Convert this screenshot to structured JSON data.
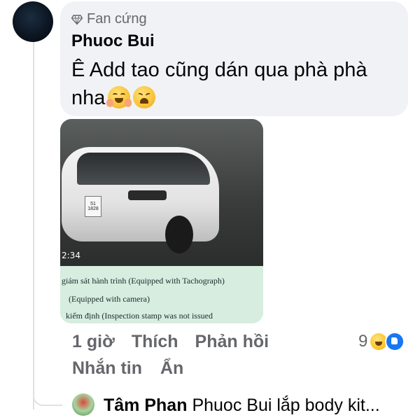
{
  "comment": {
    "badge_label": "Fan cứng",
    "badge_icon": "diamond-icon",
    "author": "Phuoc Bui",
    "text": "Ê Add tao cũng dán qua phà phà nha",
    "emojis": [
      "hugging-face-emoji",
      "tired-face-emoji"
    ]
  },
  "photo": {
    "plate_text": "51 1828",
    "timestamp": "2:34",
    "doc_lines": [
      "giám sát hành trình  (Equipped with Tachograph)",
      "(Equipped with camera)",
      "kiểm định  (Inspection stamp was not issued"
    ]
  },
  "actions": {
    "time": "1 giờ",
    "like": "Thích",
    "reply": "Phản hồi",
    "message": "Nhắn tin",
    "hide": "Ẩn"
  },
  "reactions": {
    "count": "9",
    "icons": [
      "haha-icon",
      "like-icon"
    ],
    "colors": {
      "like": "#1877f2",
      "haha": "#f4b400"
    }
  },
  "reply_preview": {
    "author": "Tâm Phan",
    "text": "Phuoc Bui lắp body kit..."
  }
}
